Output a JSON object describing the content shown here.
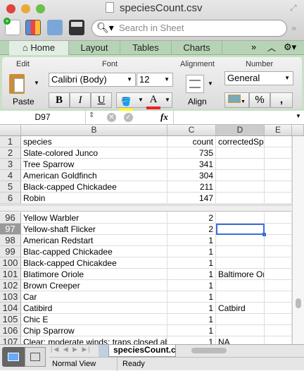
{
  "window": {
    "title": "speciesCount.csv"
  },
  "toolbar": {
    "search_placeholder": "Search in Sheet"
  },
  "tabs": [
    "Home",
    "Layout",
    "Tables",
    "Charts"
  ],
  "ribbon": {
    "groups": {
      "edit": "Edit",
      "font": "Font",
      "alignment": "Alignment",
      "number": "Number"
    },
    "paste": "Paste",
    "font_name": "Calibri (Body)",
    "font_size": "12",
    "bold": "B",
    "italic": "I",
    "underline": "U",
    "font_color": "A",
    "align": "Align",
    "number_format": "General",
    "percent": "%",
    "comma": ","
  },
  "formula_bar": {
    "cell_ref": "D97",
    "fx": "fx",
    "value": ""
  },
  "columns": [
    "B",
    "C",
    "D",
    "E"
  ],
  "top_rows": [
    {
      "n": "1",
      "b": "species",
      "c": "count",
      "d": "correctedSpecies"
    },
    {
      "n": "2",
      "b": "Slate-colored Junco",
      "c": "735",
      "d": ""
    },
    {
      "n": "3",
      "b": "Tree Sparrow",
      "c": "341",
      "d": ""
    },
    {
      "n": "4",
      "b": "American Goldfinch",
      "c": "304",
      "d": ""
    },
    {
      "n": "5",
      "b": "Black-capped Chickadee",
      "c": "211",
      "d": ""
    },
    {
      "n": "6",
      "b": "Robin",
      "c": "147",
      "d": ""
    }
  ],
  "bottom_rows": [
    {
      "n": "96",
      "b": "Yellow Warbler",
      "c": "2",
      "d": ""
    },
    {
      "n": "97",
      "b": "Yellow-shaft Flicker",
      "c": "2",
      "d": ""
    },
    {
      "n": "98",
      "b": "American Redstart",
      "c": "1",
      "d": ""
    },
    {
      "n": "99",
      "b": "Blac-capped Chickadee",
      "c": "1",
      "d": ""
    },
    {
      "n": "100",
      "b": "Black-capped Chicakdee",
      "c": "1",
      "d": ""
    },
    {
      "n": "101",
      "b": "Blatimore Oriole",
      "c": "1",
      "d": "Baltimore Oriole"
    },
    {
      "n": "102",
      "b": "Brown Creeper",
      "c": "1",
      "d": ""
    },
    {
      "n": "103",
      "b": "Car",
      "c": "1",
      "d": ""
    },
    {
      "n": "104",
      "b": "Catibird",
      "c": "1",
      "d": "Catbird"
    },
    {
      "n": "105",
      "b": "Chic E",
      "c": "1",
      "d": ""
    },
    {
      "n": "106",
      "b": "Chip Sparrow",
      "c": "1",
      "d": ""
    },
    {
      "n": "107",
      "b": "Clear; moderate winds; traps closed abc",
      "c": "1",
      "d": "NA"
    }
  ],
  "sheet_tab": "speciesCount.csv",
  "status": {
    "view": "Normal View",
    "state": "Ready"
  }
}
